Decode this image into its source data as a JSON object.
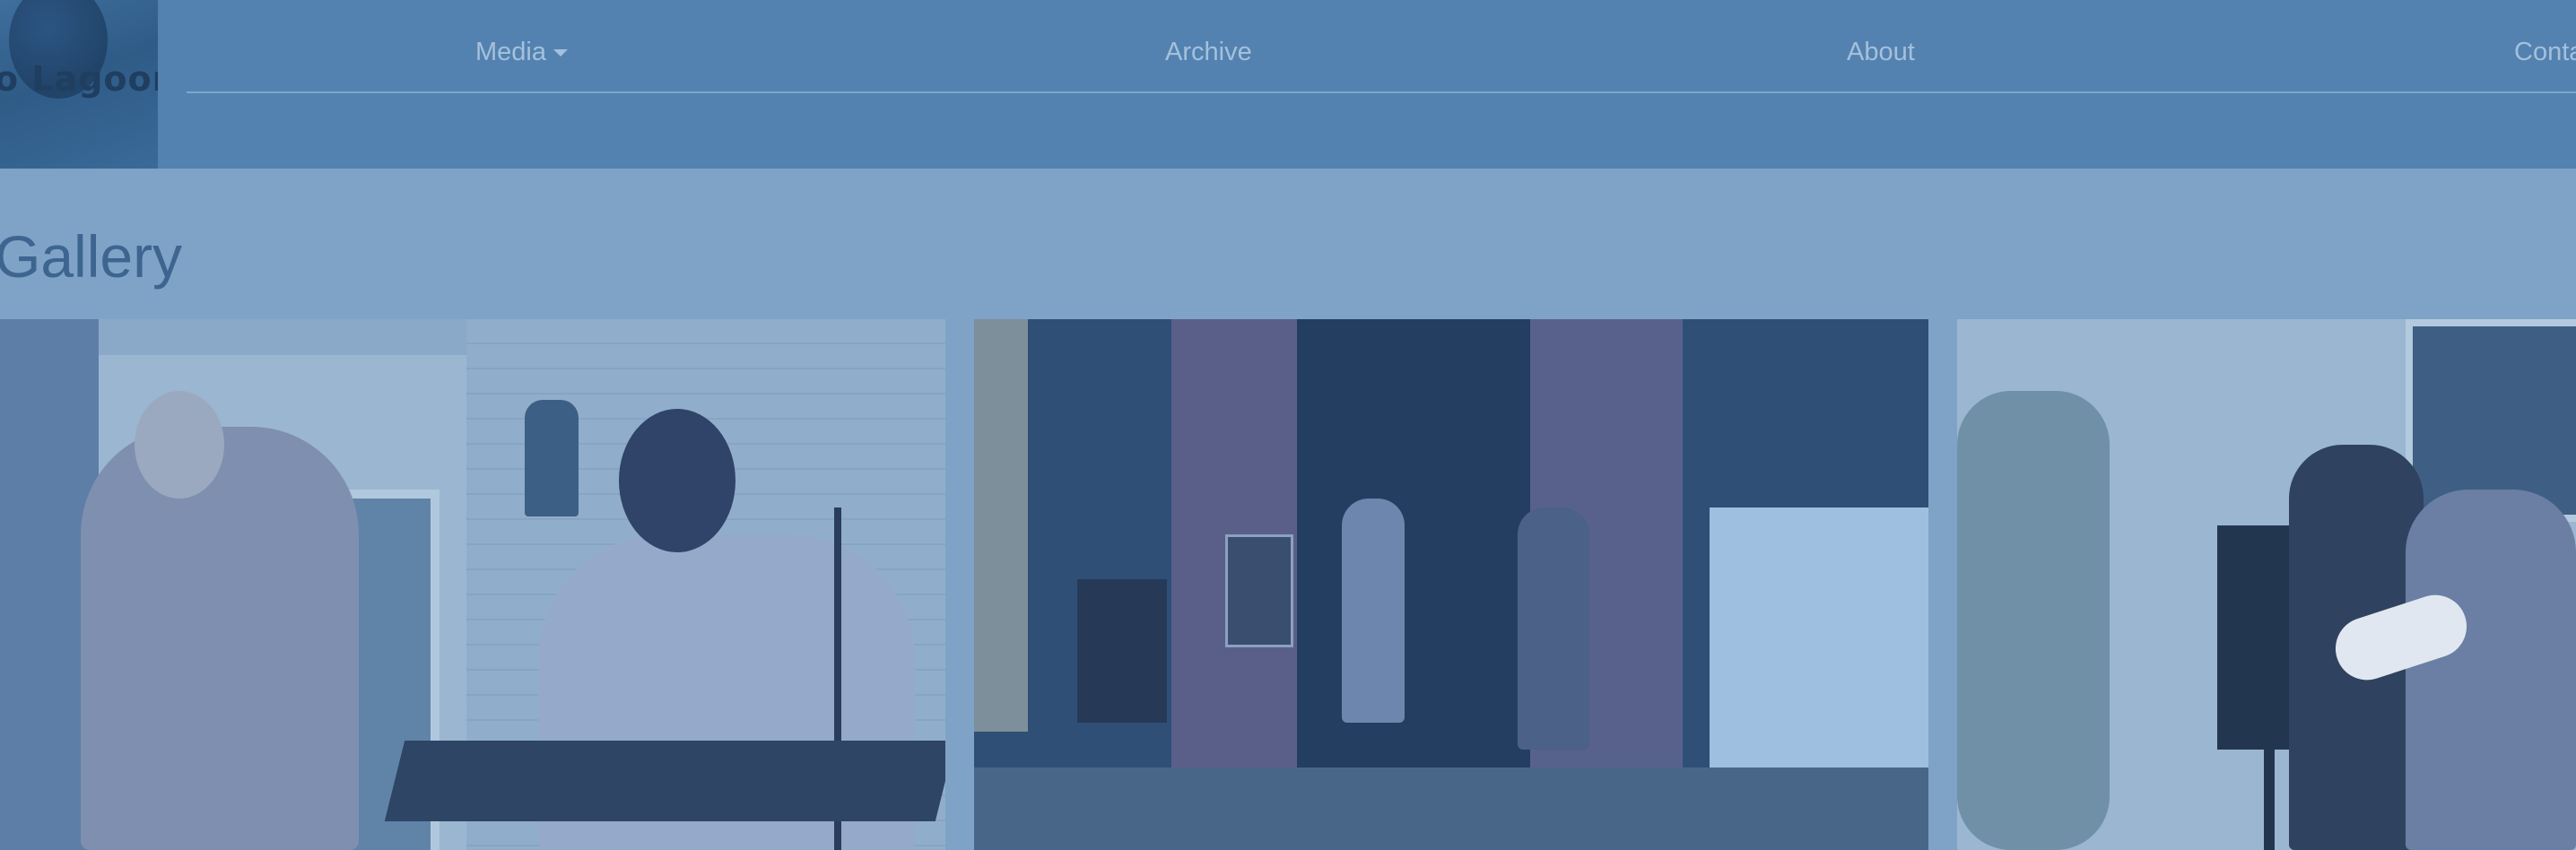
{
  "navbar": {
    "logo_text": "o Lagoon",
    "items": [
      {
        "label": "Media",
        "has_dropdown": true
      },
      {
        "label": "Archive",
        "has_dropdown": false
      },
      {
        "label": "About",
        "has_dropdown": false
      },
      {
        "label": "Conta",
        "has_dropdown": false
      }
    ]
  },
  "page": {
    "title": "Gallery"
  },
  "gallery": {
    "photos": [
      {
        "name": "gallery-photo-1"
      },
      {
        "name": "gallery-photo-2"
      },
      {
        "name": "gallery-photo-3"
      }
    ]
  },
  "colors": {
    "navbar_bg": "#5382b0",
    "page_bg": "#7fa3c6",
    "nav_text": "#a4c0dc",
    "title_text": "#3d6590"
  }
}
